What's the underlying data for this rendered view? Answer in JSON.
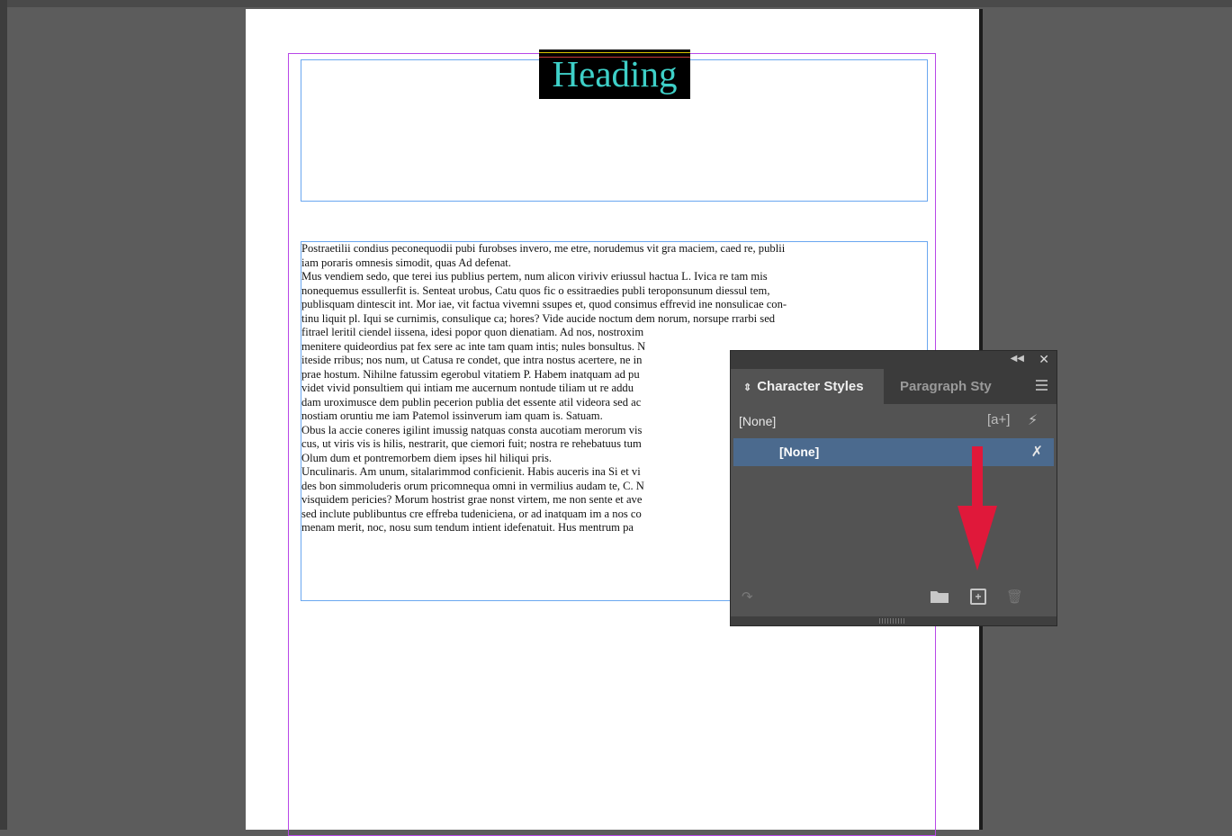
{
  "document": {
    "heading": "Heading",
    "body_lines": [
      "Postraetilii condius peconequodii pubi furobses invero, me etre, norudemus vit gra maciem, caed re, publii",
      "iam poraris omnesis simodit, quas Ad defenat.",
      "Mus vendiem sedo, que terei ius publius pertem, num alicon viriviv eriussul hactua L. Ivica re tam mis",
      "nonequemus essullerfit is. Senteat urobus, Catu quos fic o essitraedies publi teroponsunum diessul tem,",
      "publisquam dintescit int. Mor iae, vit factua vivemni ssupes et, quod consimus effrevid ine nonsulicae con-",
      "tinu liquit pl. Iqui se curnimis, consulique ca; hores? Vide aucide noctum dem norum, norsupe rrarbi sed",
      "fitrael leritil ciendel iissena, idesi popor quon dienatiam. Ad nos, nostroxim",
      "menitere quideordius pat fex sere ac inte tam quam intis; nules bonsultus. N",
      "iteside rribus; nos num, ut Catusa re condet, que intra nostus acertere, ne in",
      "prae hostum. Nihilne fatussim egerobul vitatiem P. Habem inatquam ad pu",
      "videt vivid ponsultiem qui intiam me aucernum nontude tiliam ut re addu",
      "dam uroximusce dem publin pecerion publia det essente atil videora sed ac",
      "nostiam oruntiu me iam Patemol issinverum iam quam is. Satuam.",
      "Obus la accie coneres igilint imussig natquas consta aucotiam merorum vis",
      "cus, ut viris vis is hilis, nestrarit, que ciemori fuit; nostra re rehebatuus tum",
      "Olum dum et pontremorbem diem ipses hil hiliqui pris.",
      "Unculinaris. Am unum, sitalarimmod conficienit. Habis auceris ina Si et vi",
      "des bon simmoluderis orum pricomnequa omni in vermilius audam te, C. N",
      "visquidem pericies? Morum hostrist grae nonst virtem, me non sente et ave",
      "sed inclute publibuntus cre effreba tudeniciena, or ad inatquam im a nos co",
      "menam merit, noc, nosu sum tendum intient idefenatuit. Hus mentrum pa"
    ]
  },
  "panel": {
    "tab_active": "Character Styles",
    "tab_inactive": "Paragraph Sty",
    "current_style": "[None]",
    "override_icon": "[a+]",
    "styles": [
      "[None]"
    ],
    "icons": [
      "collapse-icon",
      "close-icon",
      "panel-menu-icon",
      "new-override-icon",
      "bolt-icon",
      "clear-override-icon",
      "load-styles-icon",
      "folder-icon",
      "new-style-icon",
      "trash-icon"
    ]
  },
  "colors": {
    "canvas": "#5c5c5c",
    "heading_text": "#3ed0c8",
    "margin_guide": "#b847e8",
    "frame_border": "#6aa7f0",
    "selected_row": "#4b6a8e",
    "arrow": "#e0183a"
  }
}
